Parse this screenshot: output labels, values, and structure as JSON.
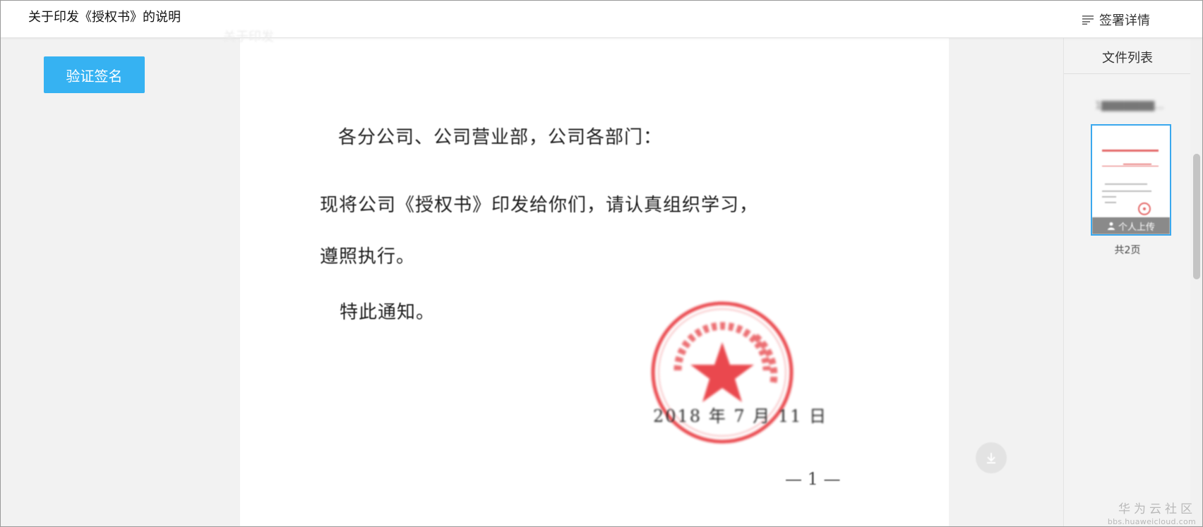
{
  "header": {
    "title": "关于印发《授权书》的说明",
    "sign_details_label": "签署详情"
  },
  "sidebar": {
    "verify_button": "验证签名"
  },
  "document": {
    "ghost_title": "关于印发",
    "salutation": "各分公司、公司营业部，公司各部门：",
    "body_line1": "现将公司《授权书》印发给你们，请认真组织学习，",
    "body_line2": "遵照执行。",
    "notice": "特此通知。",
    "date": "2018 年 7 月 11 日",
    "page_number": "— 1 —",
    "seal_color": "#e8353b"
  },
  "file_list": {
    "title": "文件列表",
    "file_name": "1▇▇▇▇▇▇▇...",
    "thumbnail_badge": "个人上传",
    "page_count": "共2页"
  },
  "watermark": {
    "brand": "华为云社区",
    "url": "bbs.huaweicloud.com"
  },
  "colors": {
    "accent": "#36b2f2",
    "thumb_border": "#3aa8ee"
  },
  "icons": {
    "sign_details": "list-lines-icon",
    "download": "download-icon",
    "thumb_badge": "user-icon",
    "seal_center": "star-icon"
  }
}
